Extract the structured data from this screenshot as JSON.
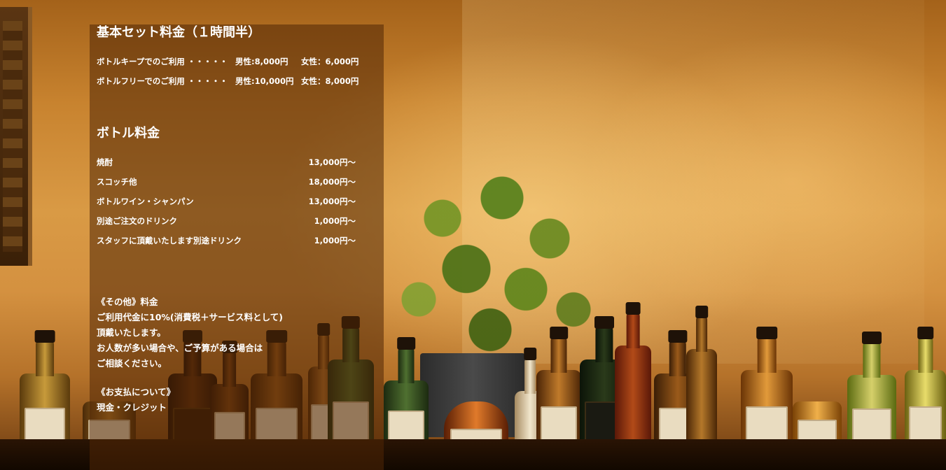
{
  "set_price": {
    "heading": "基本セット料金（１時間半）",
    "rows": [
      {
        "label": "ボトルキープでのご利用 ・・・・・",
        "male": "男性:8,000円",
        "female": "女性：6,000円"
      },
      {
        "label": "ボトルフリーでのご利用 ・・・・・",
        "male": "男性:10,000円",
        "female": "女性：8,000円"
      }
    ]
  },
  "bottle_price": {
    "heading": "ボトル料金",
    "rows": [
      {
        "name": "焼酎",
        "price": "13,000円～"
      },
      {
        "name": "スコッチ他",
        "price": "18,000円～"
      },
      {
        "name": "ボトルワイン・シャンパン",
        "price": "13,000円～"
      },
      {
        "name": "別途ご注文のドリンク",
        "price": "1,000円～"
      },
      {
        "name": "スタッフに頂戴いたします別途ドリンク",
        "price": "1,000円～"
      }
    ]
  },
  "other": {
    "heading": "《その他》料金",
    "lines": [
      "ご利用代金に10%(消費税＋サービス料として)",
      "頂戴いたします。",
      "お人数が多い場合や、ご予算がある場合は",
      "ご相談ください。"
    ]
  },
  "payment": {
    "heading": "《お支払について》",
    "text": "現金・クレジット"
  },
  "colors": {
    "panel_overlay": "#50260699",
    "text": "#ffffff",
    "wall_amber": "#d99a45"
  }
}
